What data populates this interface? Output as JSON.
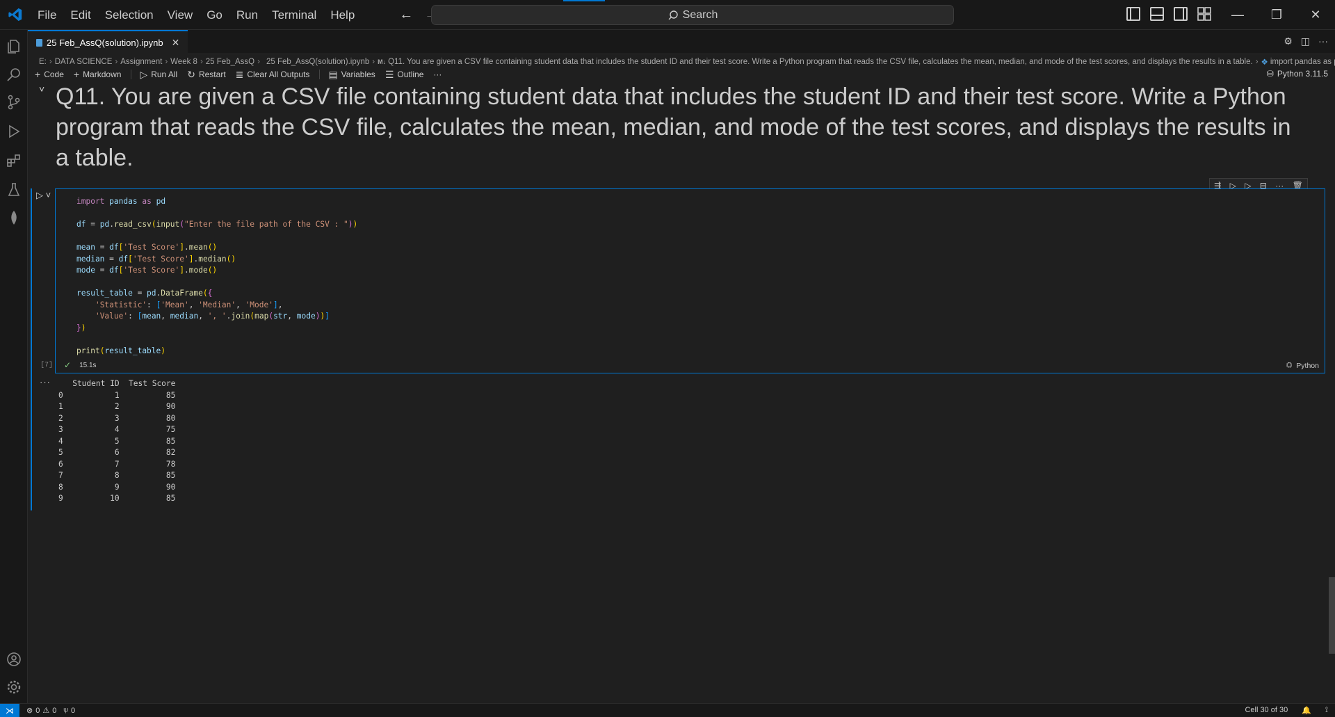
{
  "menu": [
    "File",
    "Edit",
    "Selection",
    "View",
    "Go",
    "Run",
    "Terminal",
    "Help"
  ],
  "search": {
    "label": "Search"
  },
  "tab": {
    "label": "25 Feb_AssQ(solution).ipynb"
  },
  "breadcrumb": [
    "E:",
    "DATA SCIENCE",
    "Assignment",
    "Week 8",
    "25 Feb_AssQ",
    "25 Feb_AssQ(solution).ipynb",
    "Q11. You are given a CSV file containing student data that includes the student ID and their test score. Write a Python program that reads the CSV file, calculates the mean, median, and mode of the test scores, and displays the results in a table.",
    "import pandas as pd"
  ],
  "toolbar": {
    "code": "Code",
    "markdown": "Markdown",
    "run_all": "Run All",
    "restart": "Restart",
    "clear_outputs": "Clear All Outputs",
    "variables": "Variables",
    "outline": "Outline",
    "more": "···",
    "kernel": "Python 3.11.5"
  },
  "markdown_cell": "Q11. You are given a CSV file containing student data that includes the student ID and their test score. Write a Python program that reads the CSV file, calculates the mean, median, and mode of the test scores, and displays the results in a table.",
  "code_cell": {
    "exec_count": "[7]",
    "duration": "15.1s",
    "language": "Python"
  },
  "output": {
    "header": "   Student ID  Test Score",
    "rows": [
      [
        "0",
        "1",
        "85"
      ],
      [
        "1",
        "2",
        "90"
      ],
      [
        "2",
        "3",
        "80"
      ],
      [
        "3",
        "4",
        "75"
      ],
      [
        "4",
        "5",
        "85"
      ],
      [
        "5",
        "6",
        "82"
      ],
      [
        "6",
        "7",
        "78"
      ],
      [
        "7",
        "8",
        "85"
      ],
      [
        "8",
        "9",
        "90"
      ],
      [
        "9",
        "10",
        "85"
      ]
    ]
  },
  "statusbar": {
    "errors": "0",
    "warnings": "0",
    "ports": "0",
    "cell_position": "Cell 30 of 30"
  },
  "colors": {
    "accent": "#0078d4",
    "background": "#1f1f1f"
  }
}
